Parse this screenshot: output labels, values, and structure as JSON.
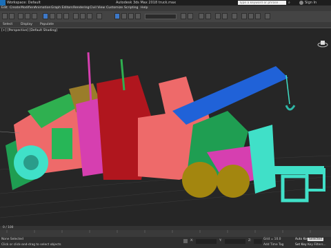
{
  "window": {
    "workspace": "Workspace: Default",
    "title": "Autodesk 3ds Max 2018    truck.max",
    "search_placeholder": "Type a keyword or phrase",
    "sign_in": "Sign In"
  },
  "menu": [
    "Edit",
    "Create",
    "Modifiers",
    "Animation",
    "Graph Editors",
    "Rendering",
    "Civil View",
    "Customize",
    "Scripting",
    "Help"
  ],
  "ribbon": {
    "tabs": [
      "Select",
      "Display",
      "Populate"
    ]
  },
  "viewport": {
    "label": "[+] [Perspective] [Default Shading]"
  },
  "timeline": {
    "position": "0 / 100"
  },
  "status": {
    "selection": "None Selected",
    "prompt": "Click or click-and-drag to select objects",
    "x_label": "X:",
    "y_label": "Y:",
    "z_label": "Z:",
    "grid": "Grid = 10.0",
    "add_time_tag": "Add Time Tag",
    "auto_key": "Auto Key",
    "selected": "Selected",
    "set_key": "Set Key",
    "key_filters": "Key Filters..."
  }
}
